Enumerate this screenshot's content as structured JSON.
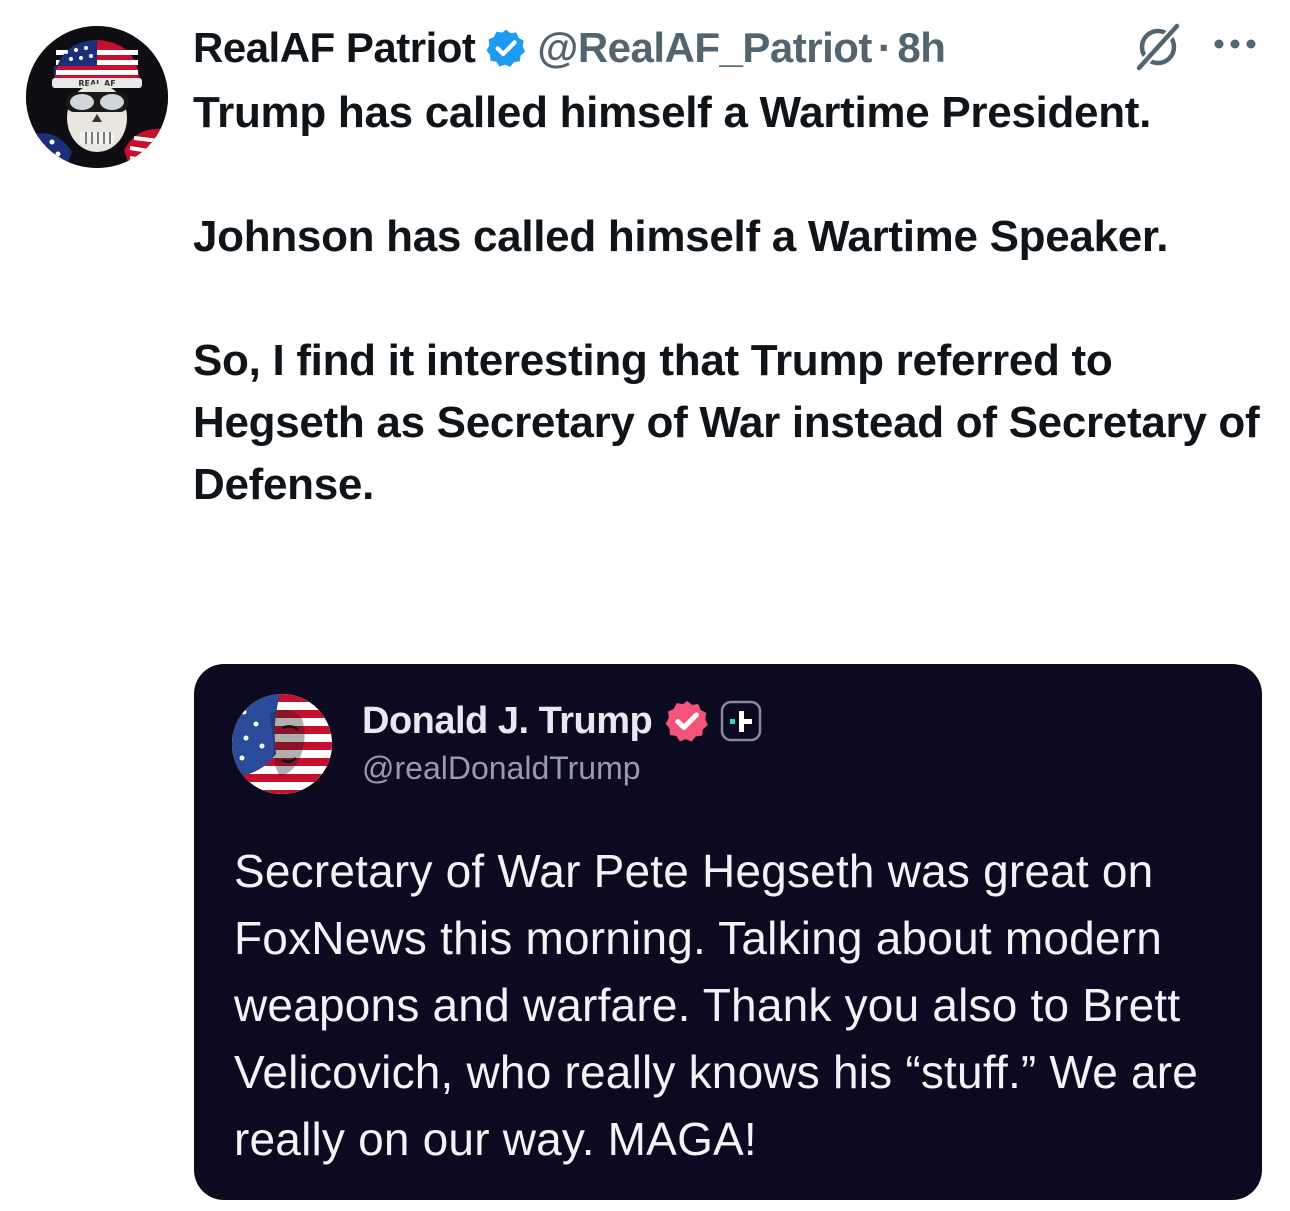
{
  "post": {
    "author_name": "RealAF Patriot",
    "handle": "@RealAF_Patriot",
    "separator": "·",
    "time": "8h",
    "avatar_cap_text": "REAL AF",
    "icons": {
      "verified": "verified-badge-icon",
      "grok": "grok-icon",
      "more": "more-options-icon"
    },
    "paragraphs": [
      "Trump has called himself a Wartime President.",
      "Johnson has called himself a Wartime Speaker.",
      "So, I find it interesting that Trump referred to Hegseth as Secretary of War instead of Secretary of Defense."
    ]
  },
  "quoted_post": {
    "author_name": "Donald J. Trump",
    "handle": "@realDonaldTrump",
    "text": "Secretary of War Pete Hegseth was great on FoxNews this morning. Talking about modern weapons and warfare. Thank you also to Brett Velicovich, who really knows his “stuff.” We are really on our way. MAGA!",
    "icons": {
      "verified": "verified-badge-icon",
      "follow": "follow-plus-icon"
    }
  },
  "colors": {
    "verified_blue": "#1d9bf0",
    "truth_verified_red": "#f4547a",
    "quote_background": "#0b0a21",
    "muted_text": "#536471"
  }
}
